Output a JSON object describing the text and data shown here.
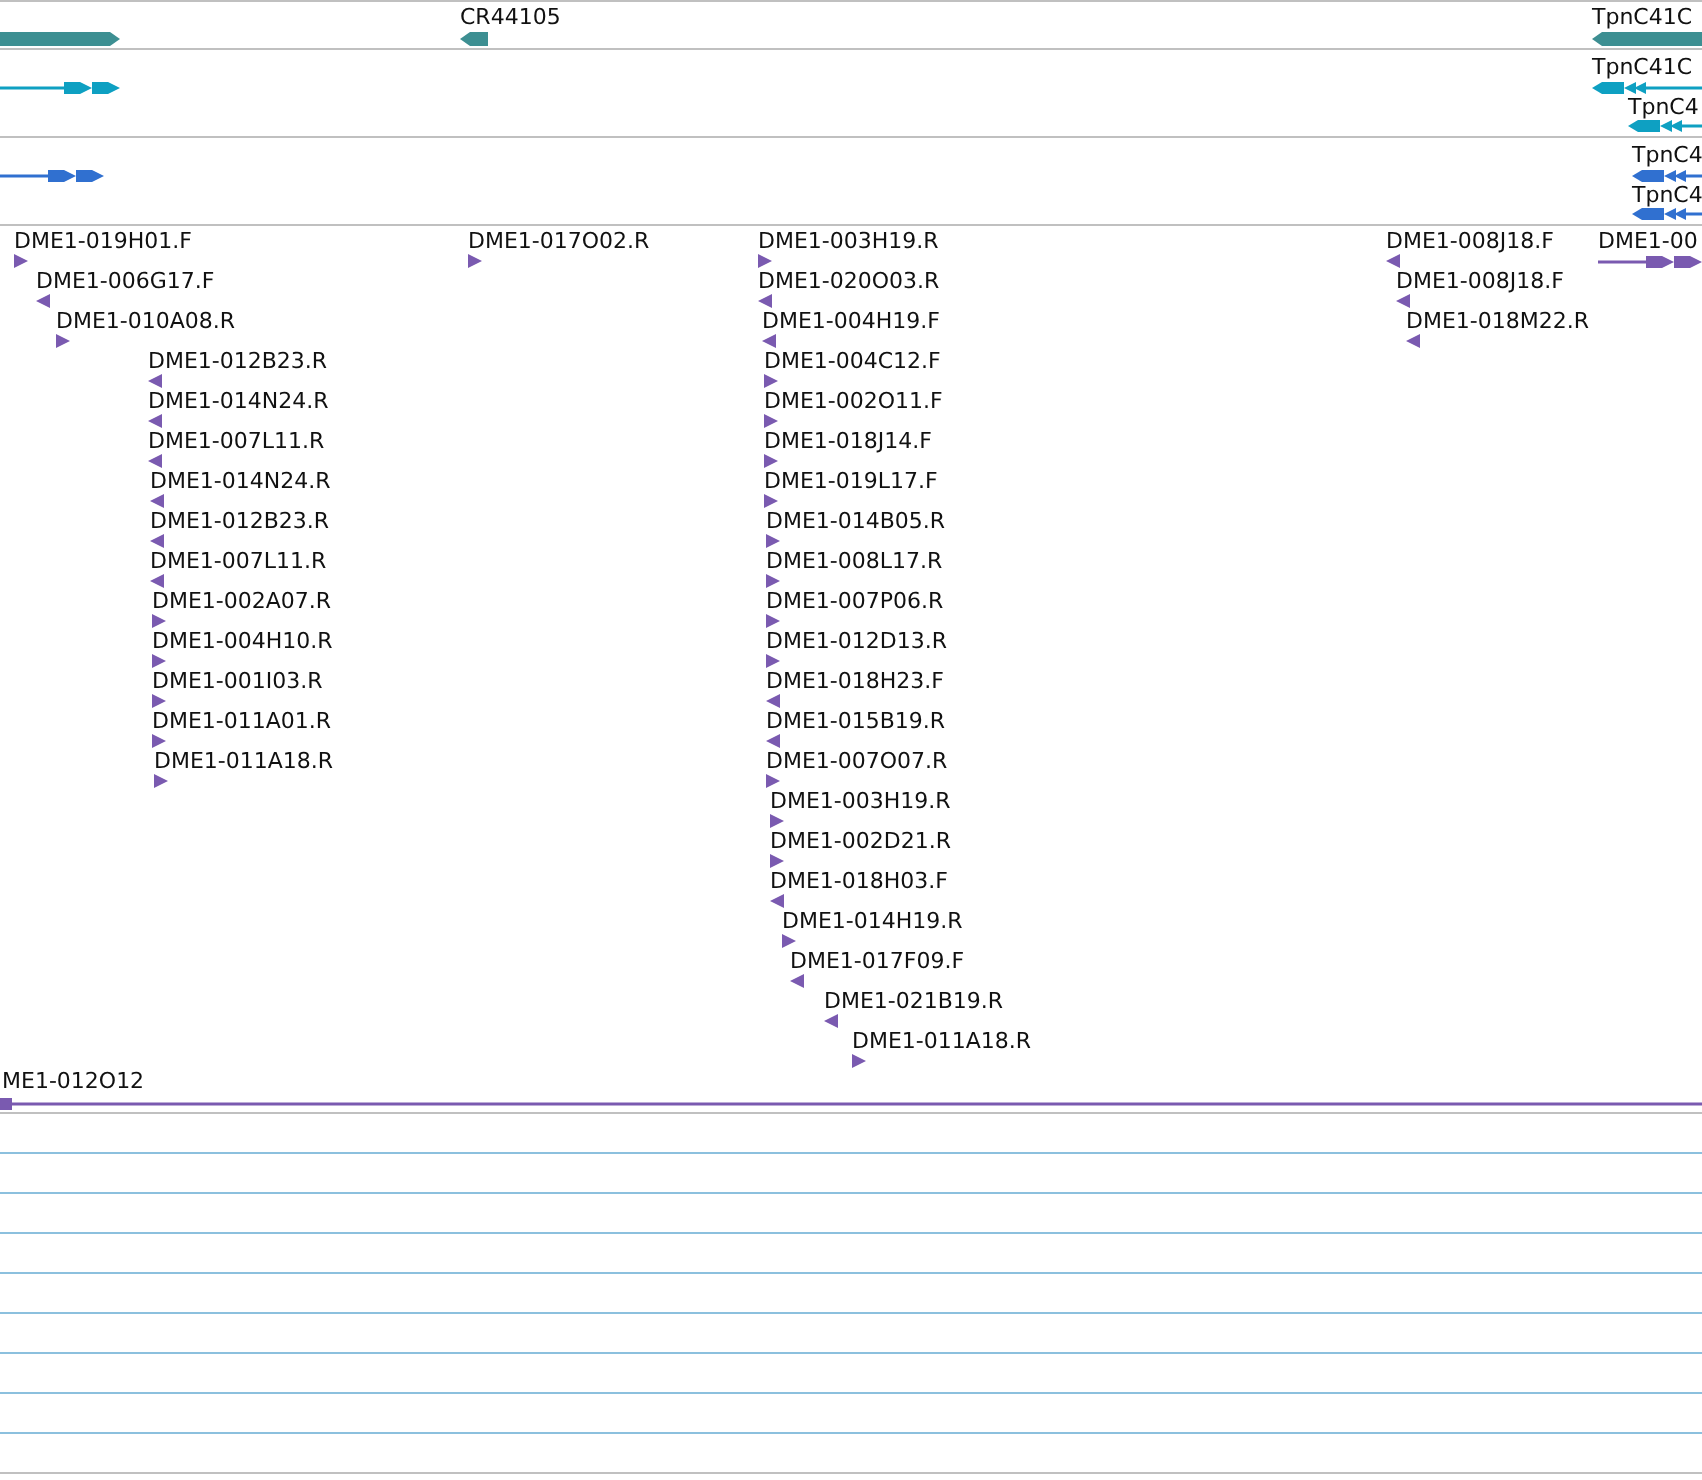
{
  "tracks": [
    {
      "color": "#3d8f92",
      "features": [
        {
          "kind": "bar",
          "reverse": false
        },
        {
          "kind": "bar",
          "reverse": true,
          "label": "CR44105"
        },
        {
          "kind": "bar",
          "reverse": true,
          "label": "TpnC41C"
        }
      ]
    },
    {
      "color": "#0ea0c2",
      "features": [
        {
          "kind": "spliced",
          "reverse": false
        },
        {
          "kind": "spliced",
          "reverse": true,
          "label": "TpnC41C"
        },
        {
          "kind": "spliced",
          "reverse": true,
          "label": "TpnC4"
        }
      ]
    },
    {
      "color": "#3070d0",
      "features": [
        {
          "kind": "spliced",
          "reverse": false
        },
        {
          "kind": "spliced",
          "reverse": true,
          "label": "TpnC4"
        },
        {
          "kind": "spliced",
          "reverse": true,
          "label": "TpnC4"
        }
      ]
    },
    {
      "color": "#7a5ab0",
      "features": [
        {
          "kind": "arrow",
          "reverse": false,
          "label": "DME1-019H01.F"
        },
        {
          "kind": "arrow",
          "reverse": true,
          "label": "DME1-006G17.F"
        },
        {
          "kind": "arrow",
          "reverse": false,
          "label": "DME1-010A08.R"
        },
        {
          "kind": "arrow",
          "reverse": true,
          "label": "DME1-012B23.R"
        },
        {
          "kind": "arrow",
          "reverse": true,
          "label": "DME1-014N24.R"
        },
        {
          "kind": "arrow",
          "reverse": true,
          "label": "DME1-007L11.R"
        },
        {
          "kind": "arrow",
          "reverse": true,
          "label": "DME1-014N24.R"
        },
        {
          "kind": "arrow",
          "reverse": true,
          "label": "DME1-012B23.R"
        },
        {
          "kind": "arrow",
          "reverse": true,
          "label": "DME1-007L11.R"
        },
        {
          "kind": "arrow",
          "reverse": false,
          "label": "DME1-002A07.R"
        },
        {
          "kind": "arrow",
          "reverse": false,
          "label": "DME1-004H10.R"
        },
        {
          "kind": "arrow",
          "reverse": false,
          "label": "DME1-001I03.R"
        },
        {
          "kind": "arrow",
          "reverse": false,
          "label": "DME1-011A01.R"
        },
        {
          "kind": "arrow",
          "reverse": false,
          "label": "DME1-011A18.R"
        },
        {
          "kind": "arrow",
          "reverse": false,
          "label": "DME1-017O02.R"
        },
        {
          "kind": "arrow",
          "reverse": false,
          "label": "DME1-003H19.R"
        },
        {
          "kind": "arrow",
          "reverse": true,
          "label": "DME1-020O03.R"
        },
        {
          "kind": "arrow",
          "reverse": true,
          "label": "DME1-004H19.F"
        },
        {
          "kind": "arrow",
          "reverse": false,
          "label": "DME1-004C12.F"
        },
        {
          "kind": "arrow",
          "reverse": false,
          "label": "DME1-002O11.F"
        },
        {
          "kind": "arrow",
          "reverse": false,
          "label": "DME1-018J14.F"
        },
        {
          "kind": "arrow",
          "reverse": false,
          "label": "DME1-019L17.F"
        },
        {
          "kind": "arrow",
          "reverse": false,
          "label": "DME1-014B05.R"
        },
        {
          "kind": "arrow",
          "reverse": false,
          "label": "DME1-008L17.R"
        },
        {
          "kind": "arrow",
          "reverse": false,
          "label": "DME1-007P06.R"
        },
        {
          "kind": "arrow",
          "reverse": false,
          "label": "DME1-012D13.R"
        },
        {
          "kind": "arrow",
          "reverse": true,
          "label": "DME1-018H23.F"
        },
        {
          "kind": "arrow",
          "reverse": true,
          "label": "DME1-015B19.R"
        },
        {
          "kind": "arrow",
          "reverse": false,
          "label": "DME1-007O07.R"
        },
        {
          "kind": "arrow",
          "reverse": false,
          "label": "DME1-003H19.R"
        },
        {
          "kind": "arrow",
          "reverse": false,
          "label": "DME1-002D21.R"
        },
        {
          "kind": "arrow",
          "reverse": true,
          "label": "DME1-018H03.F"
        },
        {
          "kind": "arrow",
          "reverse": false,
          "label": "DME1-014H19.R"
        },
        {
          "kind": "arrow",
          "reverse": true,
          "label": "DME1-017F09.F"
        },
        {
          "kind": "arrow",
          "reverse": true,
          "label": "DME1-021B19.R"
        },
        {
          "kind": "arrow",
          "reverse": false,
          "label": "DME1-011A18.R"
        },
        {
          "kind": "arrow",
          "reverse": true,
          "label": "DME1-008J18.F"
        },
        {
          "kind": "arrow",
          "reverse": true,
          "label": "DME1-008J18.F"
        },
        {
          "kind": "arrow",
          "reverse": true,
          "label": "DME1-018M22.R"
        },
        {
          "kind": "spliced",
          "reverse": false,
          "label": "DME1-00"
        },
        {
          "kind": "line",
          "label": "ME1-012O12"
        }
      ]
    }
  ]
}
